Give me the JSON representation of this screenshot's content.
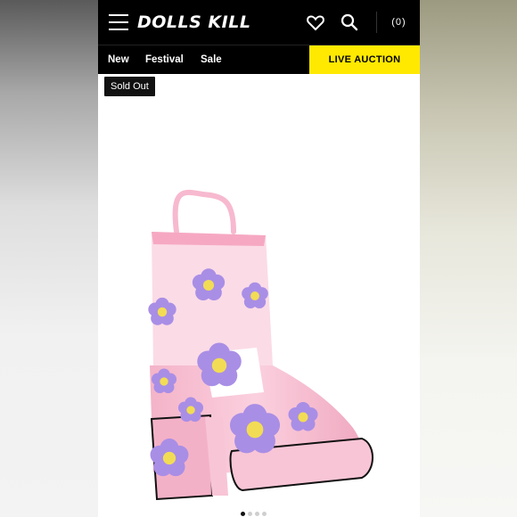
{
  "header": {
    "logo_text": "DOLLS KILL",
    "bag_count": "(0)",
    "icons": [
      "hamburger-menu-icon",
      "heart-icon",
      "search-icon"
    ]
  },
  "nav": {
    "links": [
      "New",
      "Festival",
      "Sale"
    ],
    "live_auction": "LIVE AUCTION"
  },
  "product": {
    "badge": "Sold Out",
    "image": "pink-platform-boot-with-purple-flowers"
  },
  "carousel": {
    "count": 4,
    "active_index": 0
  },
  "colors": {
    "header_bg": "#000000",
    "live_auction_bg": "#ffe900",
    "boot_pink": "#f6bcd0",
    "flower_purple": "#a98ee6",
    "flower_center": "#f2dc55"
  }
}
